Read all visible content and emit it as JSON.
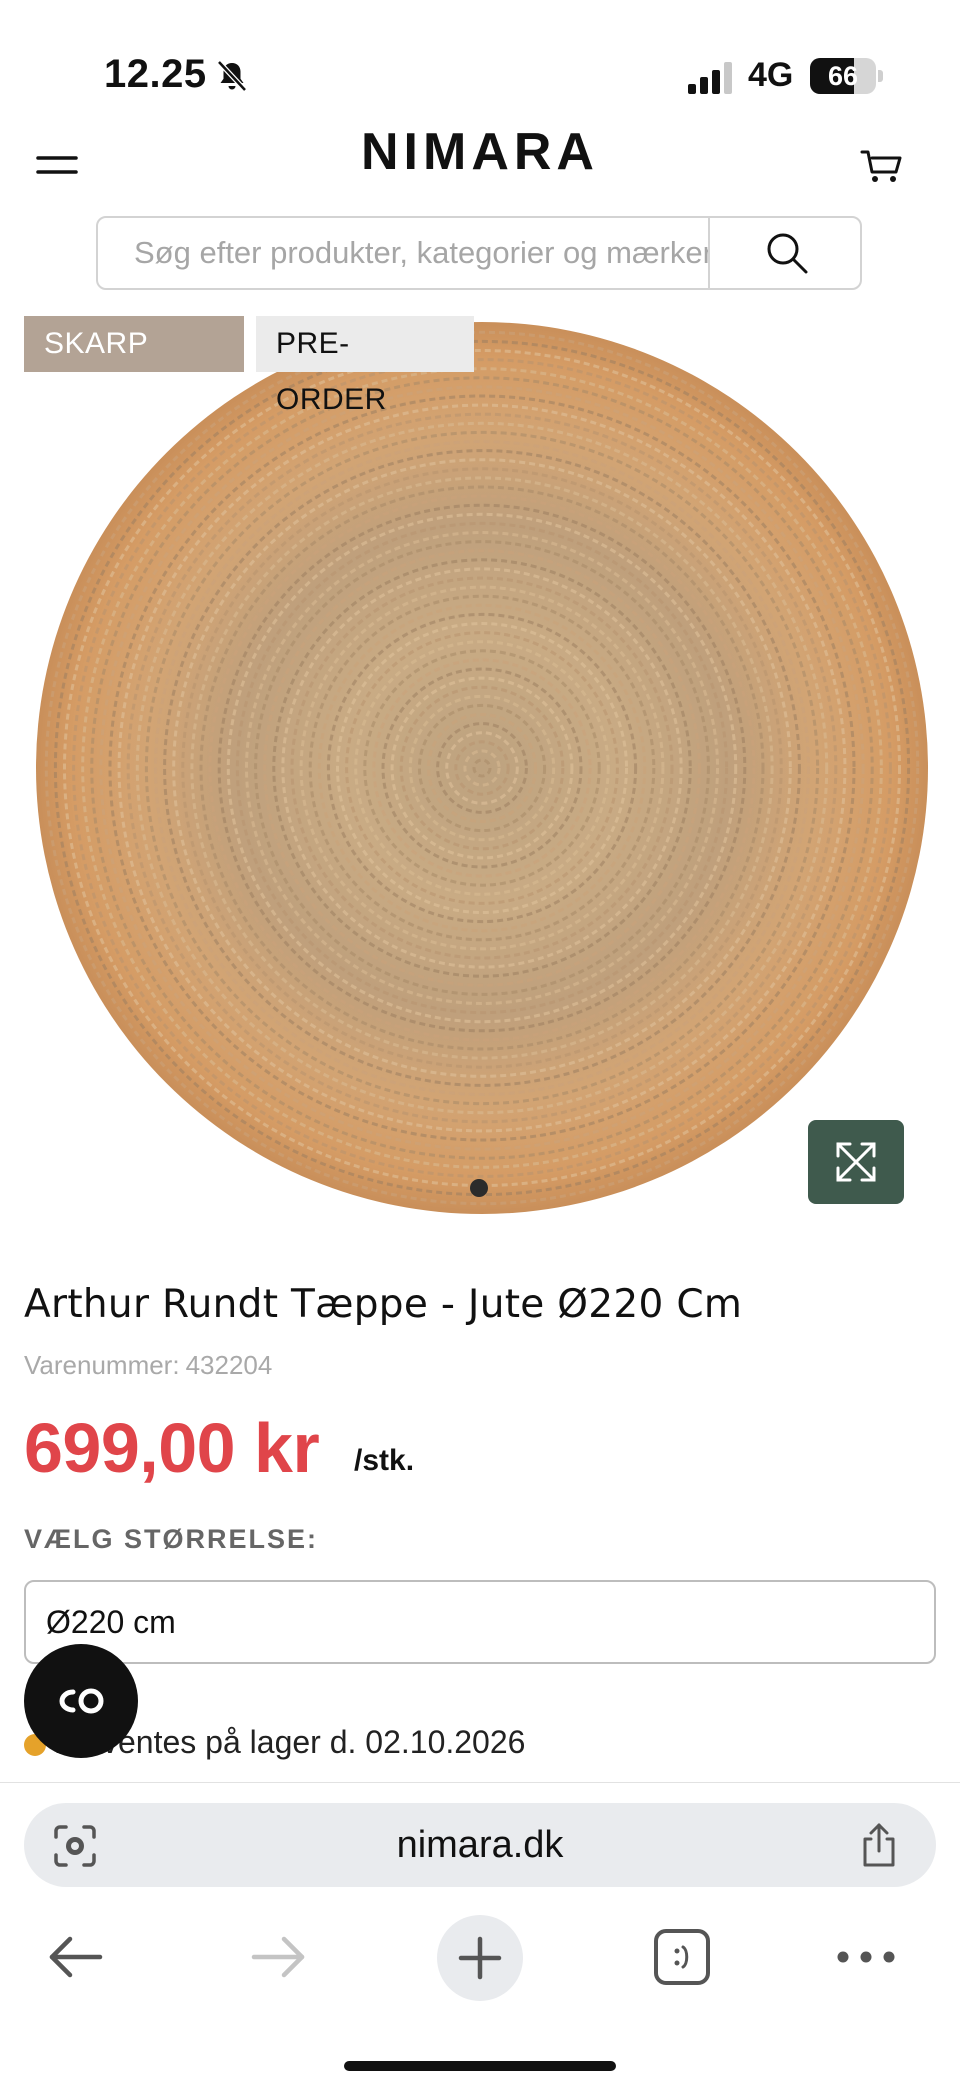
{
  "status_bar": {
    "time": "12.25",
    "network": "4G",
    "battery_level": "66",
    "battery_fraction": 0.66
  },
  "header": {
    "logo": "NIMARA"
  },
  "search": {
    "placeholder": "Søg efter produkter, kategorier og mærker"
  },
  "product": {
    "badges": [
      "SKARP PRIS",
      "PRE-ORDER"
    ],
    "title": "Arthur Rundt Tæppe - Jute Ø220 Cm",
    "sku_label": "Varenummer:",
    "sku_number": "432204",
    "price": "699,00 kr",
    "unit": "/stk.",
    "size_label": "VÆLG STØRRELSE:",
    "size_selected": "Ø220 cm",
    "stock_text": "Forventes på lager d. 02.10.2026",
    "stock_color": "#e5a22a",
    "price_color": "#e0454a",
    "carousel": {
      "current": 1,
      "total": 1
    }
  },
  "browser": {
    "url": "nimara.dk"
  },
  "colors": {
    "badge_price_bg": "#b3a395",
    "expand_button_bg": "#3f5a4d"
  }
}
